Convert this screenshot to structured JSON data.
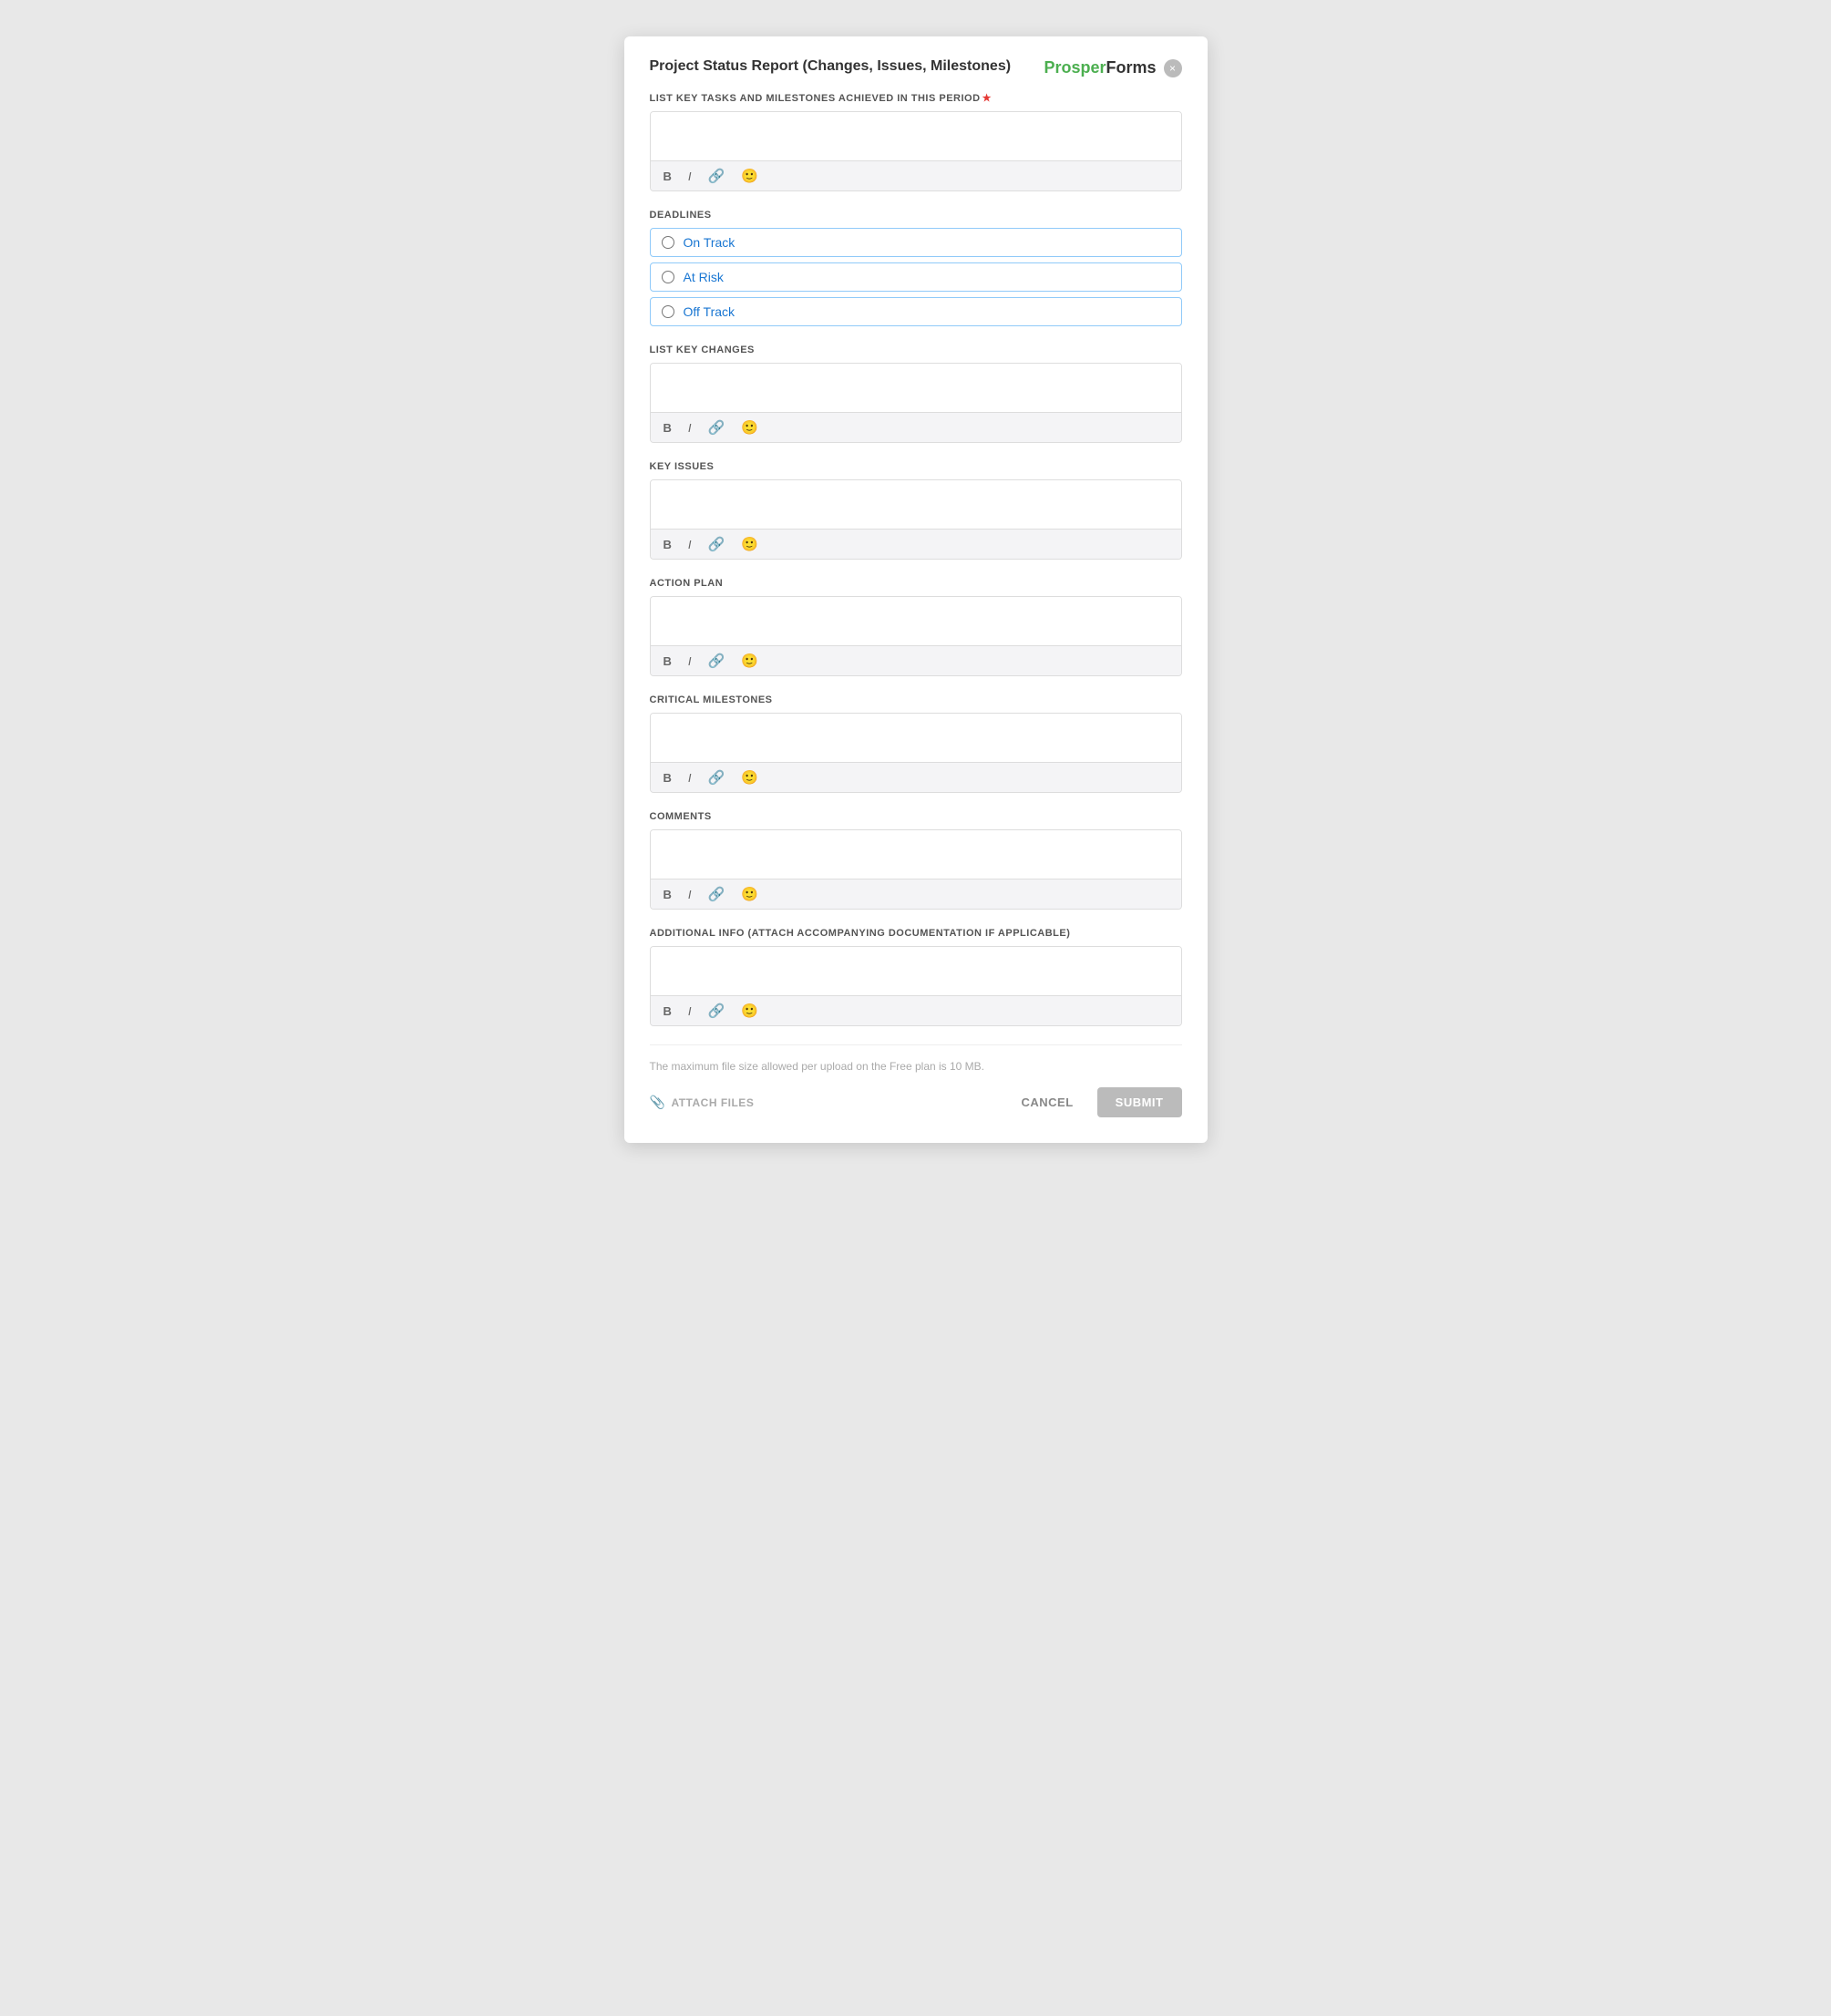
{
  "modal": {
    "title": "Project Status Report (Changes, Issues, Milestones)",
    "close_label": "×"
  },
  "brand": {
    "prosper": "Prosper",
    "forms": "Forms"
  },
  "sections": {
    "tasks_label": "LIST KEY TASKS AND MILESTONES ACHIEVED IN THIS PERIOD",
    "tasks_required": true,
    "deadlines_label": "DEADLINES",
    "deadlines_options": [
      {
        "value": "on-track",
        "label": "On Track"
      },
      {
        "value": "at-risk",
        "label": "At Risk"
      },
      {
        "value": "off-track",
        "label": "Off Track"
      }
    ],
    "key_changes_label": "LIST KEY CHANGES",
    "key_issues_label": "KEY ISSUES",
    "action_plan_label": "ACTION PLAN",
    "critical_milestones_label": "CRITICAL MILESTONES",
    "comments_label": "COMMENTS",
    "additional_info_label": "ADDITIONAL INFO (ATTACH ACCOMPANYING DOCUMENTATION IF APPLICABLE)"
  },
  "toolbar": {
    "bold": "B",
    "italic": "I",
    "link": "🔗",
    "emoji": "🙂"
  },
  "footer": {
    "file_size_note": "The maximum file size allowed per upload on the Free plan is 10 MB.",
    "attach_label": "ATTACH FILES",
    "cancel_label": "CANCEL",
    "submit_label": "SUBMIT"
  }
}
